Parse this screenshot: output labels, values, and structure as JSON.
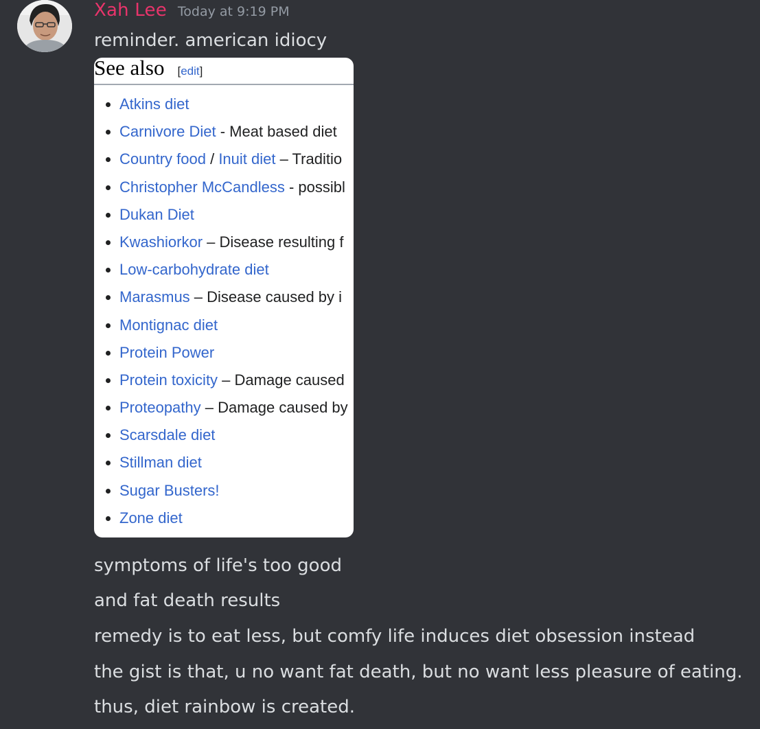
{
  "message": {
    "username": "Xah Lee",
    "timestamp": "Today at 9:19 PM",
    "first_line": "reminder. american idiocy",
    "followup_lines": [
      "symptoms of life's too good",
      "and fat death results",
      "remedy is to eat less, but comfy life induces diet obsession instead",
      "the gist is that, u no want fat death, but no want less pleasure of eating.",
      "thus, diet rainbow is created."
    ]
  },
  "embed": {
    "heading": "See also",
    "edit_open": "[",
    "edit_label": "edit",
    "edit_close": "]",
    "items": [
      {
        "links": [
          "Atkins diet"
        ],
        "text": ""
      },
      {
        "links": [
          "Carnivore Diet"
        ],
        "text": " - Meat based diet"
      },
      {
        "links": [
          "Country food",
          "Inuit diet"
        ],
        "sep": " / ",
        "text": " – Traditio"
      },
      {
        "links": [
          "Christopher McCandless"
        ],
        "text": " - possibl"
      },
      {
        "links": [
          "Dukan Diet"
        ],
        "text": ""
      },
      {
        "links": [
          "Kwashiorkor"
        ],
        "text": " – Disease resulting f"
      },
      {
        "links": [
          "Low-carbohydrate diet"
        ],
        "text": ""
      },
      {
        "links": [
          "Marasmus"
        ],
        "text": " – Disease caused by i"
      },
      {
        "links": [
          "Montignac diet"
        ],
        "text": ""
      },
      {
        "links": [
          "Protein Power"
        ],
        "text": ""
      },
      {
        "links": [
          "Protein toxicity"
        ],
        "text": " – Damage caused"
      },
      {
        "links": [
          "Proteopathy"
        ],
        "text": " – Damage caused by"
      },
      {
        "links": [
          "Scarsdale diet"
        ],
        "text": ""
      },
      {
        "links": [
          "Stillman diet"
        ],
        "text": ""
      },
      {
        "links": [
          "Sugar Busters!"
        ],
        "text": ""
      },
      {
        "links": [
          "Zone diet"
        ],
        "text": ""
      }
    ]
  },
  "colors": {
    "background": "#313338",
    "username": "#e8346b",
    "timestamp": "#949ba4",
    "message_text": "#dbdee1",
    "wiki_link": "#3366cc"
  },
  "icons": {
    "avatar": "user-avatar-photo"
  }
}
